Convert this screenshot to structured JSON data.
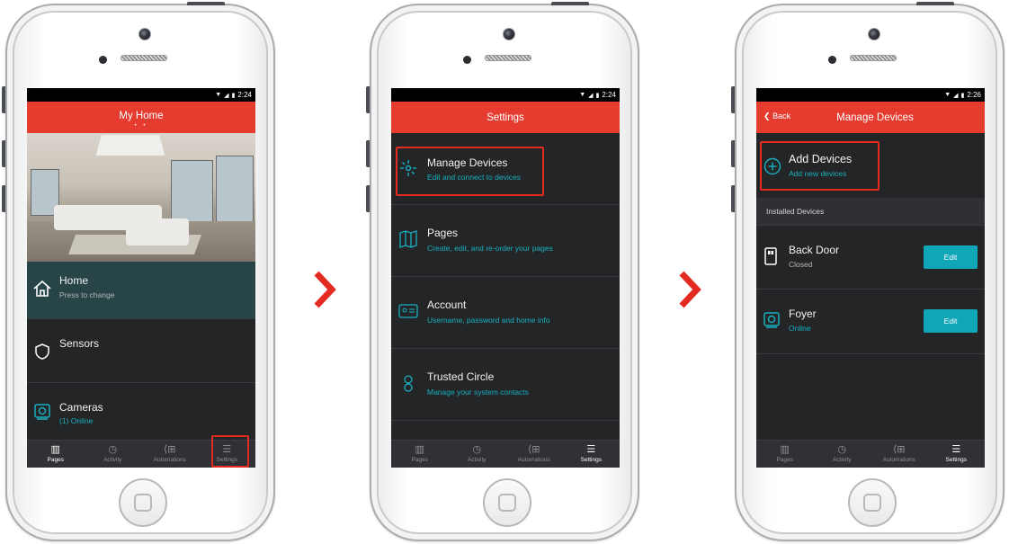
{
  "status": {
    "time1": "2:24",
    "time2": "2:24",
    "time3": "2:26"
  },
  "screen1": {
    "title": "My Home",
    "pager": "• •",
    "items": [
      {
        "label": "Home",
        "sub": "Press to change"
      },
      {
        "label": "Sensors"
      },
      {
        "label": "Cameras",
        "sub": "(1) Online"
      }
    ]
  },
  "screen2": {
    "title": "Settings",
    "items": [
      {
        "label": "Manage Devices",
        "sub": "Edit and connect to devices"
      },
      {
        "label": "Pages",
        "sub": "Create, edit, and re-order your pages"
      },
      {
        "label": "Account",
        "sub": "Username, password and home info"
      },
      {
        "label": "Trusted Circle",
        "sub": "Manage your system contacts"
      }
    ]
  },
  "screen3": {
    "back": "Back",
    "title": "Manage Devices",
    "add": {
      "label": "Add Devices",
      "sub": "Add new devices"
    },
    "section": "Installed Devices",
    "devices": [
      {
        "label": "Back Door",
        "sub": "Closed",
        "button": "Edit"
      },
      {
        "label": "Foyer",
        "sub": "Online",
        "button": "Edit"
      }
    ]
  },
  "tabs": [
    "Pages",
    "Activity",
    "Automations",
    "Settings"
  ],
  "colors": {
    "accent_red": "#e63c2f",
    "teal": "#17b0c0",
    "highlight": "#e32b21",
    "screen_bg": "#242527"
  }
}
